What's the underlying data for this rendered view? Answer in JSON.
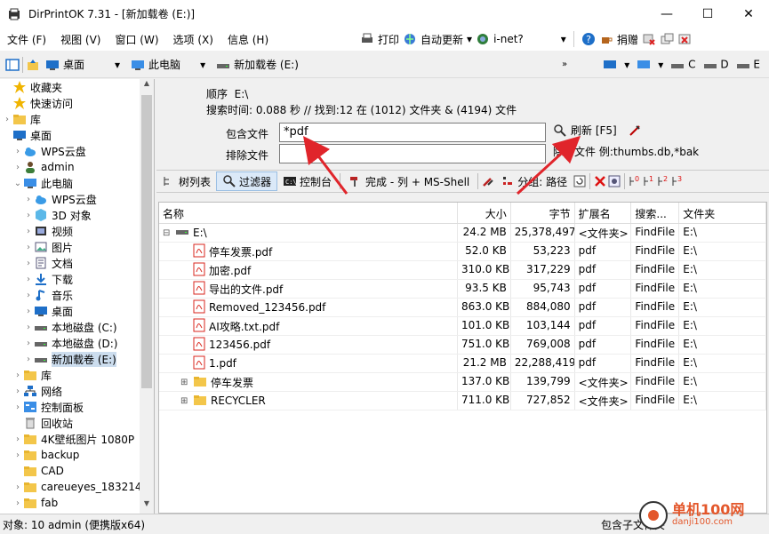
{
  "window": {
    "title": "DirPrintOK 7.31 - [新加载卷 (E:)]"
  },
  "menu": {
    "items": [
      "文件 (F)",
      "视图 (V)",
      "窗口 (W)",
      "选项 (X)",
      "信息 (H)"
    ]
  },
  "menu_right": {
    "print": "打印",
    "auto_update": "自动更新",
    "inet": "i-net?",
    "donate": "捐赠"
  },
  "toolbar": {
    "desktop": "桌面",
    "this_pc": "此电脑",
    "volume": "新加载卷 (E:)",
    "drives": [
      "C",
      "D",
      "E"
    ]
  },
  "sidebar": {
    "items": [
      {
        "label": "收藏夹",
        "icon": "star-icon"
      },
      {
        "label": "快速访问",
        "icon": "star-icon"
      },
      {
        "label": "库",
        "icon": "folder-icon"
      },
      {
        "label": "桌面",
        "icon": "desktop-icon"
      },
      {
        "label": "WPS云盘",
        "icon": "cloud-icon"
      },
      {
        "label": "admin",
        "icon": "user-icon"
      },
      {
        "label": "此电脑",
        "icon": "pc-icon"
      },
      {
        "label": "WPS云盘",
        "icon": "cloud-icon"
      },
      {
        "label": "3D 对象",
        "icon": "cube-icon"
      },
      {
        "label": "视频",
        "icon": "video-icon"
      },
      {
        "label": "图片",
        "icon": "picture-icon"
      },
      {
        "label": "文档",
        "icon": "document-icon"
      },
      {
        "label": "下载",
        "icon": "download-icon"
      },
      {
        "label": "音乐",
        "icon": "music-icon"
      },
      {
        "label": "桌面",
        "icon": "desktop-icon"
      },
      {
        "label": "本地磁盘 (C:)",
        "icon": "drive-icon"
      },
      {
        "label": "本地磁盘 (D:)",
        "icon": "drive-icon"
      },
      {
        "label": "新加载卷 (E:)",
        "icon": "drive-icon"
      },
      {
        "label": "库",
        "icon": "folder-icon"
      },
      {
        "label": "网络",
        "icon": "network-icon"
      },
      {
        "label": "控制面板",
        "icon": "control-panel-icon"
      },
      {
        "label": "回收站",
        "icon": "recycle-bin-icon"
      },
      {
        "label": "4K壁纸图片 1080P",
        "icon": "folder-icon"
      },
      {
        "label": "backup",
        "icon": "folder-icon"
      },
      {
        "label": "CAD",
        "icon": "folder-icon"
      },
      {
        "label": "careueyes_183214",
        "icon": "folder-icon"
      },
      {
        "label": "fab",
        "icon": "folder-icon"
      }
    ]
  },
  "info": {
    "order_label": "顺序",
    "order_value": "E:\\",
    "search_stats": "搜索时间: 0.088 秒 //  找到:12 在 (1012) 文件夹 & (4194) 文件"
  },
  "filter": {
    "include_label": "包含文件",
    "include_value": "*pdf",
    "exclude_label": "排除文件",
    "exclude_value": "",
    "refresh_label": "刷新 [F5]",
    "exclude_hint": "除的文件 例:thumbs.db,*bak"
  },
  "tabs": {
    "tree": "树列表",
    "filter": "过滤器",
    "console": "控制台",
    "done": "完成 - 列 + MS-Shell",
    "group": "分组: 路径"
  },
  "grid": {
    "columns": [
      "名称",
      "大小",
      "字节",
      "扩展名",
      "搜索...",
      "文件夹"
    ],
    "rows": [
      {
        "name": "E:\\",
        "size": "24.2 MB",
        "bytes": "25,378,497",
        "ext": "<文件夹>",
        "search": "FindFile",
        "folder": "E:\\",
        "type": "drive",
        "indent": 0
      },
      {
        "name": "停车发票.pdf",
        "size": "52.0 KB",
        "bytes": "53,223",
        "ext": "pdf",
        "search": "FindFile",
        "folder": "E:\\",
        "type": "pdf",
        "indent": 1
      },
      {
        "name": "加密.pdf",
        "size": "310.0 KB",
        "bytes": "317,229",
        "ext": "pdf",
        "search": "FindFile",
        "folder": "E:\\",
        "type": "pdf",
        "indent": 1
      },
      {
        "name": "导出的文件.pdf",
        "size": "93.5 KB",
        "bytes": "95,743",
        "ext": "pdf",
        "search": "FindFile",
        "folder": "E:\\",
        "type": "pdf",
        "indent": 1
      },
      {
        "name": "Removed_123456.pdf",
        "size": "863.0 KB",
        "bytes": "884,080",
        "ext": "pdf",
        "search": "FindFile",
        "folder": "E:\\",
        "type": "pdf",
        "indent": 1
      },
      {
        "name": "AI攻略.txt.pdf",
        "size": "101.0 KB",
        "bytes": "103,144",
        "ext": "pdf",
        "search": "FindFile",
        "folder": "E:\\",
        "type": "pdf",
        "indent": 1
      },
      {
        "name": "123456.pdf",
        "size": "751.0 KB",
        "bytes": "769,008",
        "ext": "pdf",
        "search": "FindFile",
        "folder": "E:\\",
        "type": "pdf",
        "indent": 1
      },
      {
        "name": "1.pdf",
        "size": "21.2 MB",
        "bytes": "22,288,419",
        "ext": "pdf",
        "search": "FindFile",
        "folder": "E:\\",
        "type": "pdf",
        "indent": 1
      },
      {
        "name": "停车发票",
        "size": "137.0 KB",
        "bytes": "139,799",
        "ext": "<文件夹>",
        "search": "FindFile",
        "folder": "E:\\",
        "type": "folder",
        "indent": 1
      },
      {
        "name": "RECYCLER",
        "size": "711.0 KB",
        "bytes": "727,852",
        "ext": "<文件夹>",
        "search": "FindFile",
        "folder": "E:\\",
        "type": "folder",
        "indent": 1
      }
    ]
  },
  "status": {
    "left": "对象: 10  admin (便携版x64)",
    "right": "包含子文件夹"
  },
  "watermark": {
    "text": "单机100网",
    "url": "danji100.com"
  },
  "colors": {
    "accent": "#1e6fc8",
    "arrow": "#e0252b",
    "pdf": "#d9261c",
    "folder": "#f3c64a"
  }
}
